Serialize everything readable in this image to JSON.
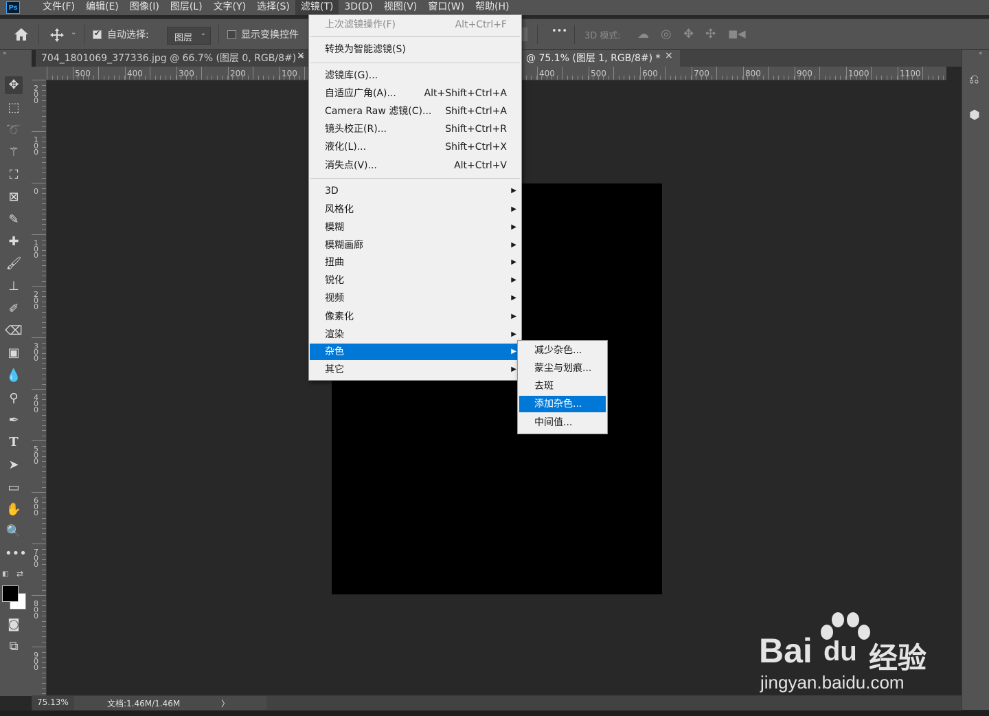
{
  "menubar": {
    "logo": "Ps",
    "items": [
      "文件(F)",
      "编辑(E)",
      "图像(I)",
      "图层(L)",
      "文字(Y)",
      "选择(S)",
      "滤镜(T)",
      "3D(D)",
      "视图(V)",
      "窗口(W)",
      "帮助(H)"
    ],
    "active": "滤镜(T)"
  },
  "options": {
    "auto_select_label": "自动选择:",
    "auto_select_checked": true,
    "auto_select_target": "图层",
    "show_transform_label": "显示变换控件",
    "show_transform_checked": false,
    "more_label": "•••",
    "mode_3d_label": "3D 模式:"
  },
  "tabs": [
    {
      "title": "704_1801069_377336.jpg @ 66.7% (图层 0, RGB/8#) *",
      "close": "×",
      "active": false
    },
    {
      "title": "@ 75.1% (图层 1, RGB/8#) *",
      "close": "×",
      "active": true
    }
  ],
  "ruler": {
    "h_labels": [
      "500",
      "400",
      "300",
      "200",
      "100",
      "400",
      "500",
      "600",
      "700",
      "800",
      "900",
      "1000",
      "1100"
    ],
    "v_labels": [
      "200",
      "100",
      "0",
      "100",
      "200",
      "300",
      "400",
      "500",
      "600",
      "700",
      "800",
      "900"
    ]
  },
  "filter_menu": {
    "items": [
      {
        "label": "上次滤镜操作(F)",
        "shortcut": "Alt+Ctrl+F",
        "disabled": true
      },
      {
        "label": "转换为智能滤镜(S)",
        "shortcut": ""
      },
      {
        "label": "滤镜库(G)...",
        "shortcut": ""
      },
      {
        "label": "自适应广角(A)...",
        "shortcut": "Alt+Shift+Ctrl+A"
      },
      {
        "label": "Camera Raw 滤镜(C)...",
        "shortcut": "Shift+Ctrl+A"
      },
      {
        "label": "镜头校正(R)...",
        "shortcut": "Shift+Ctrl+R"
      },
      {
        "label": "液化(L)...",
        "shortcut": "Shift+Ctrl+X"
      },
      {
        "label": "消失点(V)...",
        "shortcut": "Alt+Ctrl+V"
      },
      {
        "label": "3D",
        "submenu": true
      },
      {
        "label": "风格化",
        "submenu": true
      },
      {
        "label": "模糊",
        "submenu": true
      },
      {
        "label": "模糊画廊",
        "submenu": true
      },
      {
        "label": "扭曲",
        "submenu": true
      },
      {
        "label": "锐化",
        "submenu": true
      },
      {
        "label": "视频",
        "submenu": true
      },
      {
        "label": "像素化",
        "submenu": true
      },
      {
        "label": "渲染",
        "submenu": true
      },
      {
        "label": "杂色",
        "submenu": true,
        "highlighted": true
      },
      {
        "label": "其它",
        "submenu": true
      }
    ]
  },
  "noise_submenu": {
    "items": [
      {
        "label": "减少杂色..."
      },
      {
        "label": "蒙尘与划痕..."
      },
      {
        "label": "去斑"
      },
      {
        "label": "添加杂色...",
        "highlighted": true
      },
      {
        "label": "中间值..."
      }
    ]
  },
  "status": {
    "zoom": "75.13%",
    "doc": "文档:1.46M/1.46M",
    "arrow": "〉"
  },
  "watermark": {
    "brand": "Bai",
    "brand2": "du",
    "cn": "经验",
    "url": "jingyan.baidu.com"
  },
  "colors": {
    "highlight": "#0078d7",
    "canvas": "#000000",
    "workspace": "#282828",
    "chrome": "#535353"
  }
}
